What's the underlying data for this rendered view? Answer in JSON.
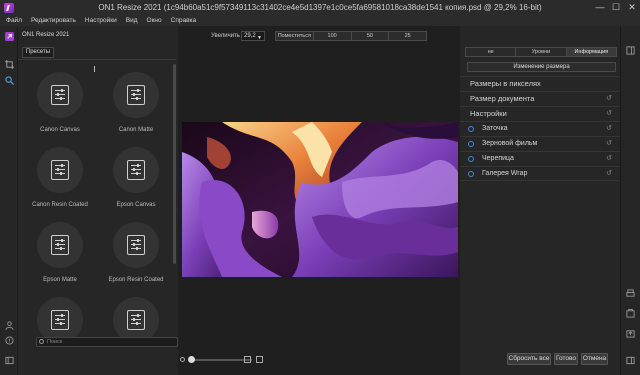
{
  "window": {
    "title": "ON1 Resize 2021 (1c94b60a51c9f57349113c31402ce4e5d1397e1c0ce5fa69581018ca38de1541 копия.psd @ 29,2% 16-bit)",
    "minimize": "—",
    "maximize": "☐",
    "close": "✕"
  },
  "menu": {
    "items": [
      "Файл",
      "Редактировать",
      "Настройки",
      "Вид",
      "Окно",
      "Справка"
    ]
  },
  "left_panel": {
    "app_name": "ON1 Resize 2021",
    "tab_presets": "Пресеты",
    "search_placeholder": "Поиск",
    "presets": [
      {
        "label": "Canon Canvas"
      },
      {
        "label": "Canon Matte"
      },
      {
        "label": "Canon Resin Coated"
      },
      {
        "label": "Epson Canvas"
      },
      {
        "label": "Epson Matte"
      },
      {
        "label": "Epson Resin Coated"
      },
      {
        "label": ""
      },
      {
        "label": ""
      }
    ]
  },
  "toolbar": {
    "zoom_label": "Увеличить",
    "zoom_value": "29,2",
    "fit_label": "Поместиться",
    "zoom_100": "100",
    "zoom_50": "50",
    "zoom_25": "25"
  },
  "right_panel": {
    "tabs": [
      "не",
      "Уровни",
      "Информация"
    ],
    "active_tab": "Информация",
    "resize_button": "Изменение размера",
    "sections": [
      {
        "label": "Размеры в пикселях",
        "has_reset": false,
        "has_circle": false
      },
      {
        "label": "Размер документа",
        "has_reset": true,
        "has_circle": false
      },
      {
        "label": "Настройки",
        "has_reset": true,
        "has_circle": false
      },
      {
        "label": "Заточка",
        "has_reset": true,
        "has_circle": true
      },
      {
        "label": "Зерновой фильм",
        "has_reset": true,
        "has_circle": true
      },
      {
        "label": "Черепица",
        "has_reset": true,
        "has_circle": true
      },
      {
        "label": "Галерея Wrap",
        "has_reset": true,
        "has_circle": true
      }
    ],
    "reset_glyph": "↺"
  },
  "bottom": {
    "reset_all": "Сбросить все",
    "done": "Готово",
    "cancel": "Отмена"
  },
  "colors": {
    "accent_circle": "#3d8bd6",
    "app_logo": "#a23fd0"
  },
  "icons": {
    "left_rail": [
      "logo-icon",
      "crop-icon",
      "zoom-icon",
      "user-icon",
      "help-icon",
      "panel-icon"
    ],
    "right_rail": [
      "panel-toggle-icon",
      "print-icon",
      "export-icon",
      "split-icon"
    ]
  }
}
